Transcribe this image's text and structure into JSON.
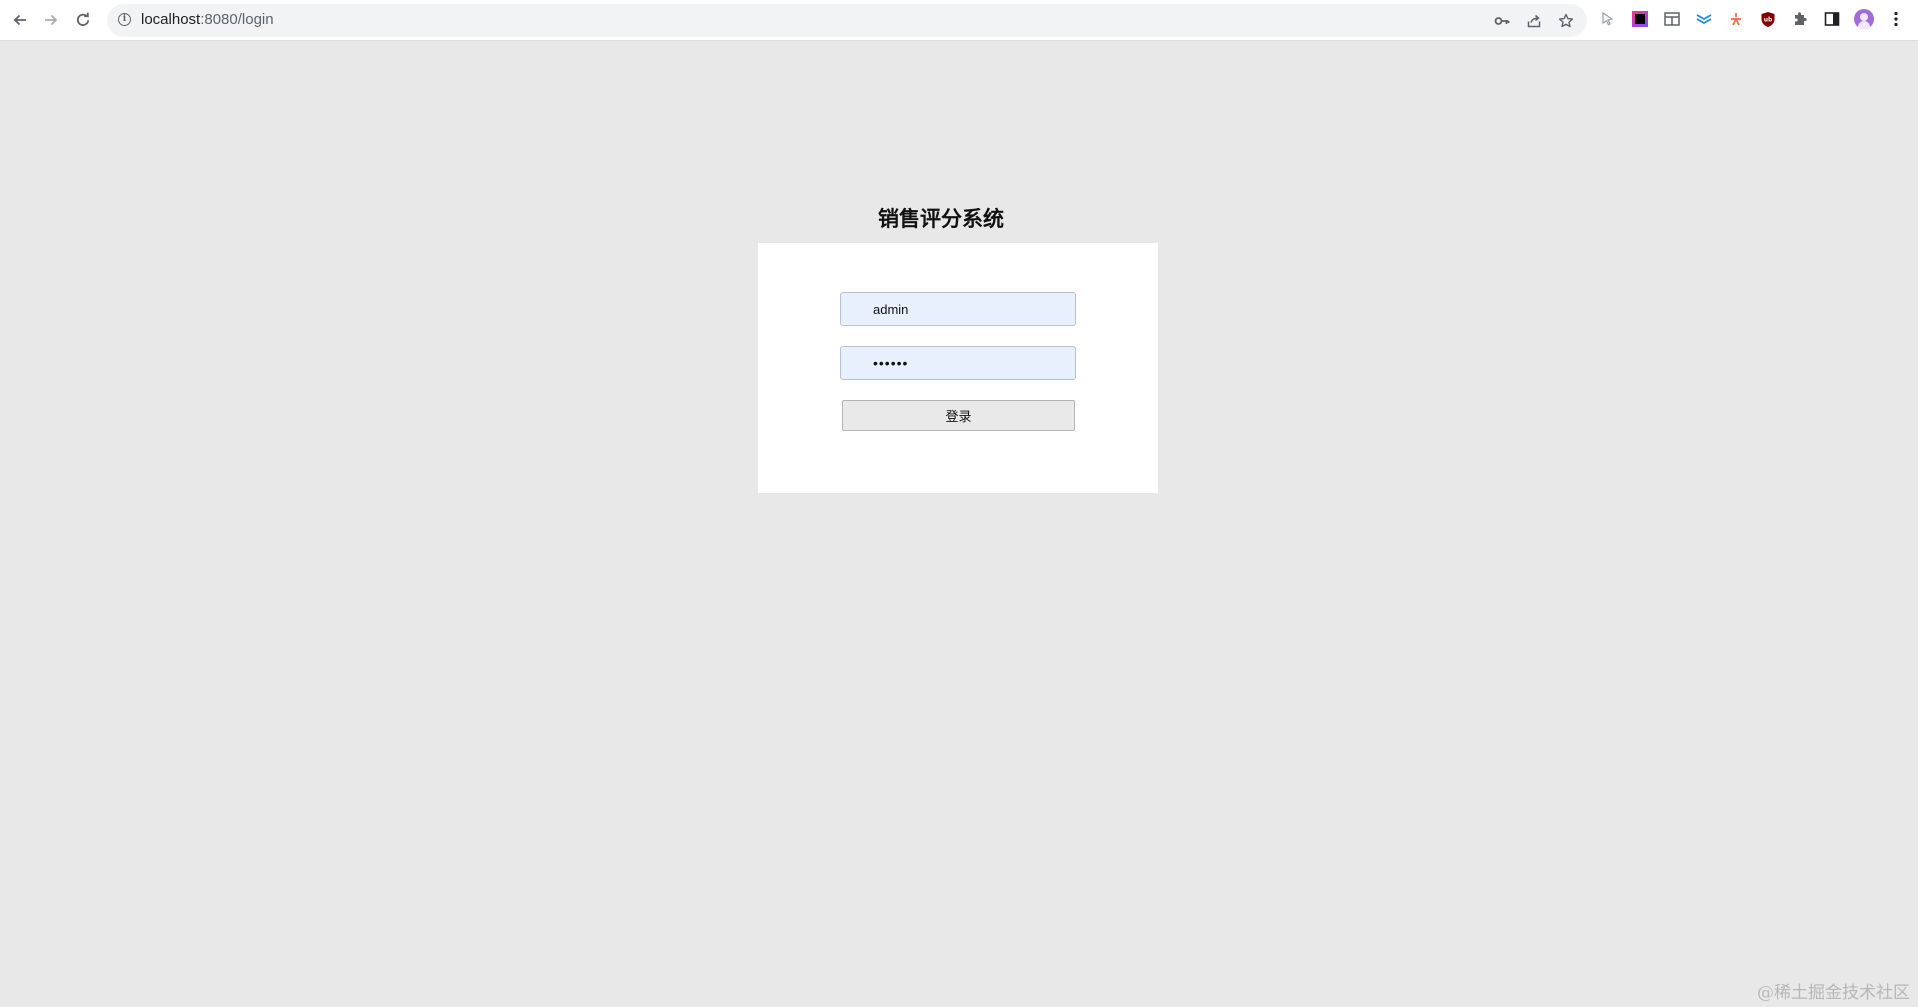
{
  "browser": {
    "url_host": "localhost",
    "url_path": ":8080/login"
  },
  "page": {
    "title": "销售评分系统",
    "username_value": "admin",
    "password_value": "••••••",
    "login_label": "登录"
  },
  "watermark": "@稀土掘金技术社区",
  "icons": {
    "back": "back-arrow-icon",
    "forward": "forward-arrow-icon",
    "reload": "reload-icon",
    "info": "info-icon",
    "key": "key-icon",
    "share": "share-icon",
    "star": "bookmark-star-icon",
    "menu": "kebab-menu-icon"
  },
  "colors": {
    "page_bg": "#e8e8e8",
    "card_bg": "#ffffff",
    "autofill_bg": "#e8f0fe",
    "button_bg": "#e9e9e9"
  }
}
